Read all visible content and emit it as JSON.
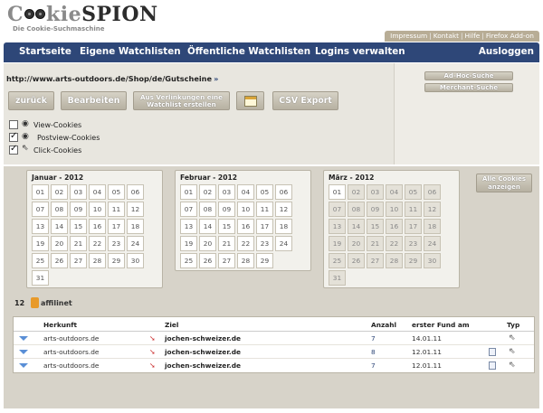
{
  "logo": {
    "prefix": "C",
    "mid": "kie",
    "brand": "SPION",
    "tagline": "Die Cookie-Suchmaschine"
  },
  "toplinks": [
    "Impressum",
    "Kontakt",
    "Hilfe",
    "Firefox Add-on"
  ],
  "nav": {
    "items": [
      "Startseite",
      "Eigene Watchlisten",
      "Öffentliche Watchlisten",
      "Logins verwalten"
    ],
    "logout": "Ausloggen"
  },
  "url": {
    "text": "http://www.arts-outdoors.de/Shop/de/Gutscheine",
    "arrow": "»"
  },
  "buttons": {
    "back": "zurück",
    "edit": "Bearbeiten",
    "link_line1": "Aus Verlinkungen eine",
    "link_line2": "Watchlist erstellen",
    "csv": "CSV Export"
  },
  "search": {
    "adhoc": "Ad-Hoc-Suche",
    "merchant": "Merchant-Suche"
  },
  "filters": [
    {
      "label": "View-Cookies",
      "checked": false,
      "icon": "eye-icon"
    },
    {
      "label": "Postview-Cookies",
      "checked": true,
      "icon": "eye-cursor-icon"
    },
    {
      "label": "Click-Cookies",
      "checked": true,
      "icon": "cursor-icon"
    }
  ],
  "calendars": [
    {
      "title": "Januar - 2012",
      "days": [
        "01",
        "02",
        "03",
        "04",
        "05",
        "06",
        "07",
        "08",
        "09",
        "10",
        "11",
        "12",
        "13",
        "14",
        "15",
        "16",
        "17",
        "18",
        "19",
        "20",
        "21",
        "22",
        "23",
        "24",
        "25",
        "26",
        "27",
        "28",
        "29",
        "30",
        "31"
      ],
      "dim": []
    },
    {
      "title": "Februar - 2012",
      "days": [
        "01",
        "02",
        "03",
        "04",
        "05",
        "06",
        "07",
        "08",
        "09",
        "10",
        "11",
        "12",
        "13",
        "14",
        "15",
        "16",
        "17",
        "18",
        "19",
        "20",
        "21",
        "22",
        "23",
        "24",
        "25",
        "26",
        "27",
        "28",
        "29"
      ],
      "dim": []
    },
    {
      "title": "März - 2012",
      "days": [
        "01",
        "02",
        "03",
        "04",
        "05",
        "06",
        "07",
        "08",
        "09",
        "10",
        "11",
        "12",
        "13",
        "14",
        "15",
        "16",
        "17",
        "18",
        "19",
        "20",
        "21",
        "22",
        "23",
        "24",
        "25",
        "26",
        "27",
        "28",
        "29",
        "30",
        "31"
      ],
      "dim": [
        "02",
        "03",
        "04",
        "05",
        "06",
        "07",
        "08",
        "09",
        "10",
        "11",
        "12",
        "13",
        "14",
        "15",
        "16",
        "17",
        "18",
        "19",
        "20",
        "21",
        "22",
        "23",
        "24",
        "25",
        "26",
        "27",
        "28",
        "29",
        "30",
        "31"
      ]
    }
  ],
  "all_cookies": {
    "line1": "Alle Cookies",
    "line2": "anzeigen"
  },
  "network": {
    "count": "12",
    "name": "affilinet"
  },
  "table": {
    "headers": {
      "origin": "Herkunft",
      "target": "Ziel",
      "count": "Anzahl",
      "first": "erster Fund am",
      "type": "Typ"
    },
    "rows": [
      {
        "origin": "arts-outdoors.de",
        "target": "jochen-schweizer.de",
        "count": "7",
        "first": "14.01.11",
        "has_doc": false
      },
      {
        "origin": "arts-outdoors.de",
        "target": "jochen-schweizer.de",
        "count": "8",
        "first": "12.01.11",
        "has_doc": true
      },
      {
        "origin": "arts-outdoors.de",
        "target": "jochen-schweizer.de",
        "count": "7",
        "first": "12.01.11",
        "has_doc": true
      }
    ]
  }
}
